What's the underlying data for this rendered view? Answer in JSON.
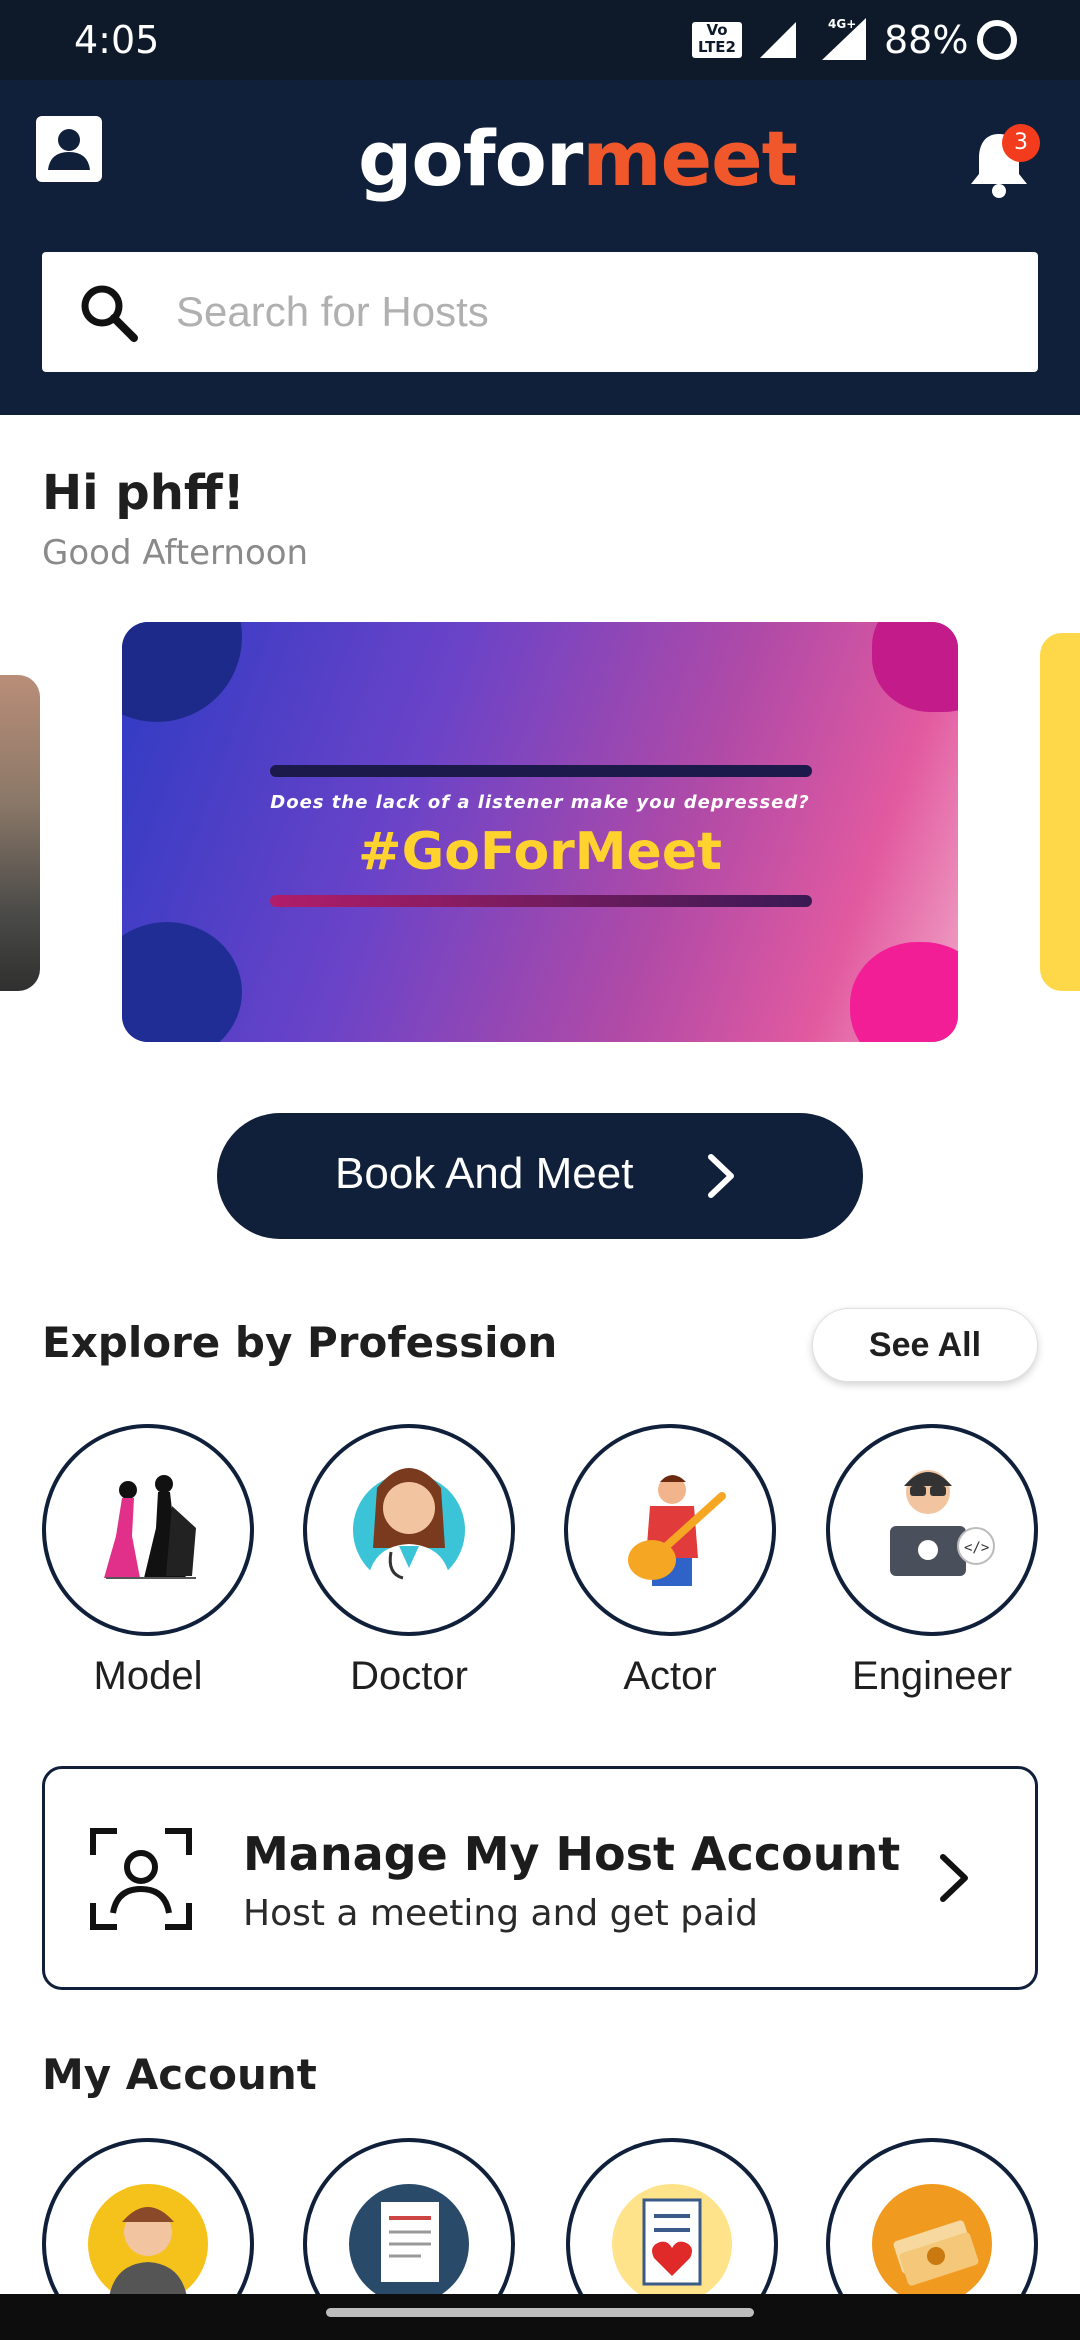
{
  "status_bar": {
    "time": "4:05",
    "network_badge": "Vo LTE 2",
    "network_type": "4G+",
    "battery": "88%"
  },
  "header": {
    "logo_part1": "gofor",
    "logo_part2": "meet",
    "notification_count": "3",
    "brand_colors": {
      "navy": "#10203a",
      "orange": "#f0582c"
    }
  },
  "search": {
    "placeholder": "Search for Hosts",
    "value": ""
  },
  "greeting": {
    "hello": "Hi phff!",
    "subtitle": "Good Afternoon"
  },
  "banner": {
    "tagline": "Does the lack of a listener make you depressed?",
    "hashtag": "#GoForMeet"
  },
  "book_button": {
    "label": "Book And Meet"
  },
  "explore": {
    "title": "Explore by Profession",
    "see_all": "See All",
    "professions": [
      {
        "label": "Model",
        "icon": "model-icon"
      },
      {
        "label": "Doctor",
        "icon": "doctor-icon"
      },
      {
        "label": "Actor",
        "icon": "actor-icon"
      },
      {
        "label": "Engineer",
        "icon": "engineer-icon"
      }
    ]
  },
  "host_card": {
    "title": "Manage My Host Account",
    "description": "Host a meeting and get paid"
  },
  "my_account": {
    "title": "My Account",
    "items": [
      {
        "icon": "profile-avatar-icon"
      },
      {
        "icon": "document-icon"
      },
      {
        "icon": "favorites-list-icon"
      },
      {
        "icon": "money-icon"
      }
    ]
  }
}
